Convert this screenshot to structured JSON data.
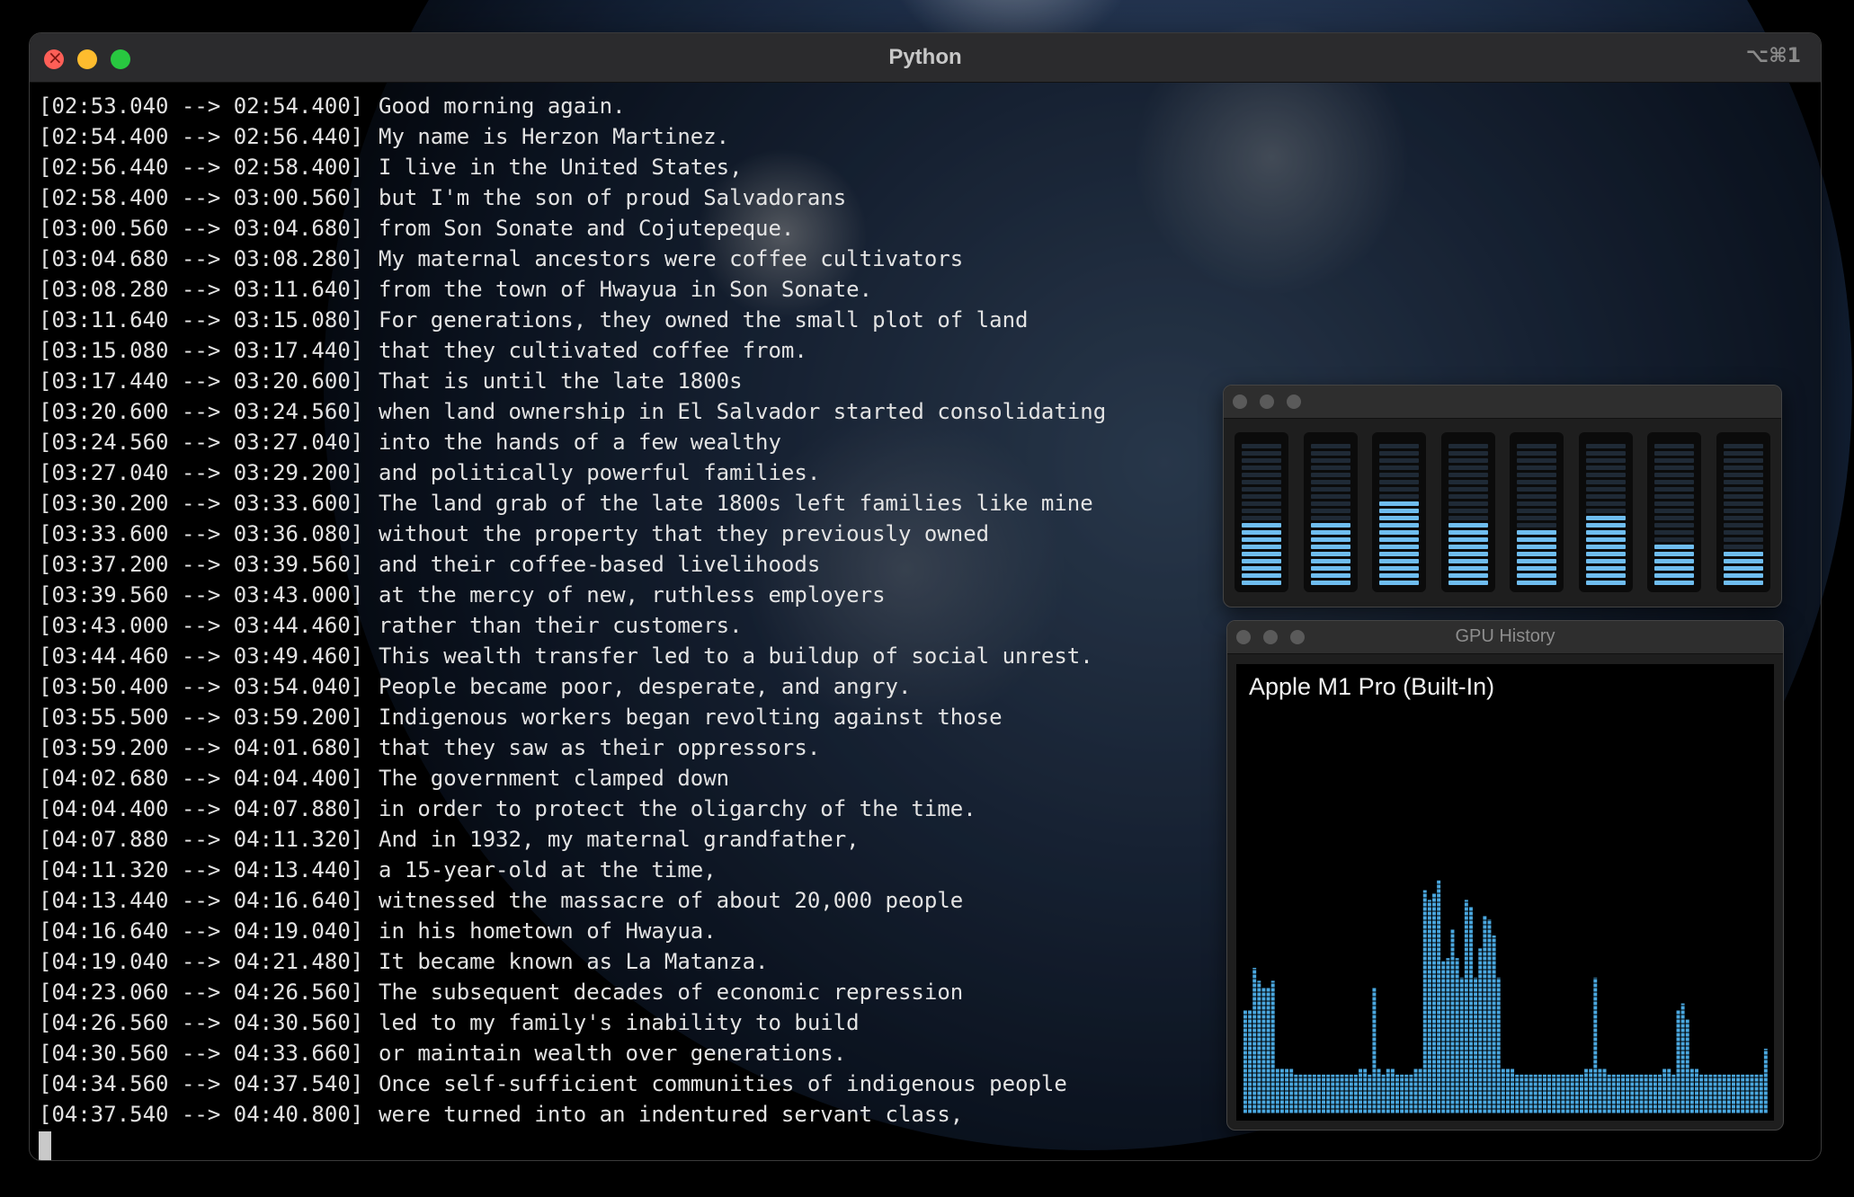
{
  "window": {
    "title": "Python",
    "shortcut": "⌥⌘1"
  },
  "transcript": [
    {
      "ts": "[02:53.040 --> 02:54.400]",
      "text": "Good morning again."
    },
    {
      "ts": "[02:54.400 --> 02:56.440]",
      "text": "My name is Herzon Martinez."
    },
    {
      "ts": "[02:56.440 --> 02:58.400]",
      "text": "I live in the United States,"
    },
    {
      "ts": "[02:58.400 --> 03:00.560]",
      "text": "but I'm the son of proud Salvadorans"
    },
    {
      "ts": "[03:00.560 --> 03:04.680]",
      "text": "from Son Sonate and Cojutepeque."
    },
    {
      "ts": "[03:04.680 --> 03:08.280]",
      "text": "My maternal ancestors were coffee cultivators"
    },
    {
      "ts": "[03:08.280 --> 03:11.640]",
      "text": "from the town of Hwayua in Son Sonate."
    },
    {
      "ts": "[03:11.640 --> 03:15.080]",
      "text": "For generations, they owned the small plot of land"
    },
    {
      "ts": "[03:15.080 --> 03:17.440]",
      "text": "that they cultivated coffee from."
    },
    {
      "ts": "[03:17.440 --> 03:20.600]",
      "text": "That is until the late 1800s"
    },
    {
      "ts": "[03:20.600 --> 03:24.560]",
      "text": "when land ownership in El Salvador started consolidating"
    },
    {
      "ts": "[03:24.560 --> 03:27.040]",
      "text": "into the hands of a few wealthy"
    },
    {
      "ts": "[03:27.040 --> 03:29.200]",
      "text": "and politically powerful families."
    },
    {
      "ts": "[03:30.200 --> 03:33.600]",
      "text": "The land grab of the late 1800s left families like mine"
    },
    {
      "ts": "[03:33.600 --> 03:36.080]",
      "text": "without the property that they previously owned"
    },
    {
      "ts": "[03:37.200 --> 03:39.560]",
      "text": "and their coffee-based livelihoods"
    },
    {
      "ts": "[03:39.560 --> 03:43.000]",
      "text": "at the mercy of new, ruthless employers"
    },
    {
      "ts": "[03:43.000 --> 03:44.460]",
      "text": "rather than their customers."
    },
    {
      "ts": "[03:44.460 --> 03:49.460]",
      "text": "This wealth transfer led to a buildup of social unrest."
    },
    {
      "ts": "[03:50.400 --> 03:54.040]",
      "text": "People became poor, desperate, and angry."
    },
    {
      "ts": "[03:55.500 --> 03:59.200]",
      "text": "Indigenous workers began revolting against those"
    },
    {
      "ts": "[03:59.200 --> 04:01.680]",
      "text": "that they saw as their oppressors."
    },
    {
      "ts": "[04:02.680 --> 04:04.400]",
      "text": "The government clamped down"
    },
    {
      "ts": "[04:04.400 --> 04:07.880]",
      "text": "in order to protect the oligarchy of the time."
    },
    {
      "ts": "[04:07.880 --> 04:11.320]",
      "text": "And in 1932, my maternal grandfather,"
    },
    {
      "ts": "[04:11.320 --> 04:13.440]",
      "text": "a 15-year-old at the time,"
    },
    {
      "ts": "[04:13.440 --> 04:16.640]",
      "text": "witnessed the massacre of about 20,000 people"
    },
    {
      "ts": "[04:16.640 --> 04:19.040]",
      "text": "in his hometown of Hwayua."
    },
    {
      "ts": "[04:19.040 --> 04:21.480]",
      "text": "It became known as La Matanza."
    },
    {
      "ts": "[04:23.060 --> 04:26.560]",
      "text": "The subsequent decades of economic repression"
    },
    {
      "ts": "[04:26.560 --> 04:30.560]",
      "text": "led to my family's inability to build"
    },
    {
      "ts": "[04:30.560 --> 04:33.660]",
      "text": "or maintain wealth over generations."
    },
    {
      "ts": "[04:34.560 --> 04:37.540]",
      "text": "Once self-sufficient communities of indigenous people"
    },
    {
      "ts": "[04:37.540 --> 04:40.800]",
      "text": "were turned into an indentured servant class,"
    }
  ],
  "cpu_panel": {
    "core_load_fraction": [
      0.46,
      0.46,
      0.61,
      0.46,
      0.41,
      0.51,
      0.31,
      0.26
    ]
  },
  "gpu_panel": {
    "title": "GPU History",
    "gpu_name": "Apple M1 Pro (Built-In)",
    "history_fraction": [
      0.32,
      0.32,
      0.45,
      0.41,
      0.39,
      0.39,
      0.41,
      0.14,
      0.14,
      0.14,
      0.14,
      0.12,
      0.12,
      0.12,
      0.12,
      0.12,
      0.12,
      0.12,
      0.12,
      0.12,
      0.12,
      0.12,
      0.12,
      0.12,
      0.12,
      0.14,
      0.14,
      0.12,
      0.39,
      0.14,
      0.12,
      0.14,
      0.14,
      0.12,
      0.12,
      0.12,
      0.12,
      0.14,
      0.14,
      0.69,
      0.66,
      0.68,
      0.72,
      0.47,
      0.48,
      0.57,
      0.48,
      0.42,
      0.66,
      0.64,
      0.42,
      0.51,
      0.61,
      0.6,
      0.55,
      0.42,
      0.14,
      0.14,
      0.14,
      0.12,
      0.12,
      0.12,
      0.12,
      0.12,
      0.12,
      0.12,
      0.12,
      0.12,
      0.12,
      0.12,
      0.12,
      0.12,
      0.12,
      0.12,
      0.14,
      0.14,
      0.42,
      0.14,
      0.14,
      0.12,
      0.12,
      0.12,
      0.12,
      0.12,
      0.12,
      0.12,
      0.12,
      0.12,
      0.12,
      0.12,
      0.12,
      0.14,
      0.14,
      0.12,
      0.32,
      0.34,
      0.29,
      0.14,
      0.14,
      0.12,
      0.12,
      0.12,
      0.12,
      0.12,
      0.12,
      0.12,
      0.12,
      0.12,
      0.12,
      0.12,
      0.12,
      0.12,
      0.12,
      0.2
    ],
    "color": "#4aa8e0"
  }
}
